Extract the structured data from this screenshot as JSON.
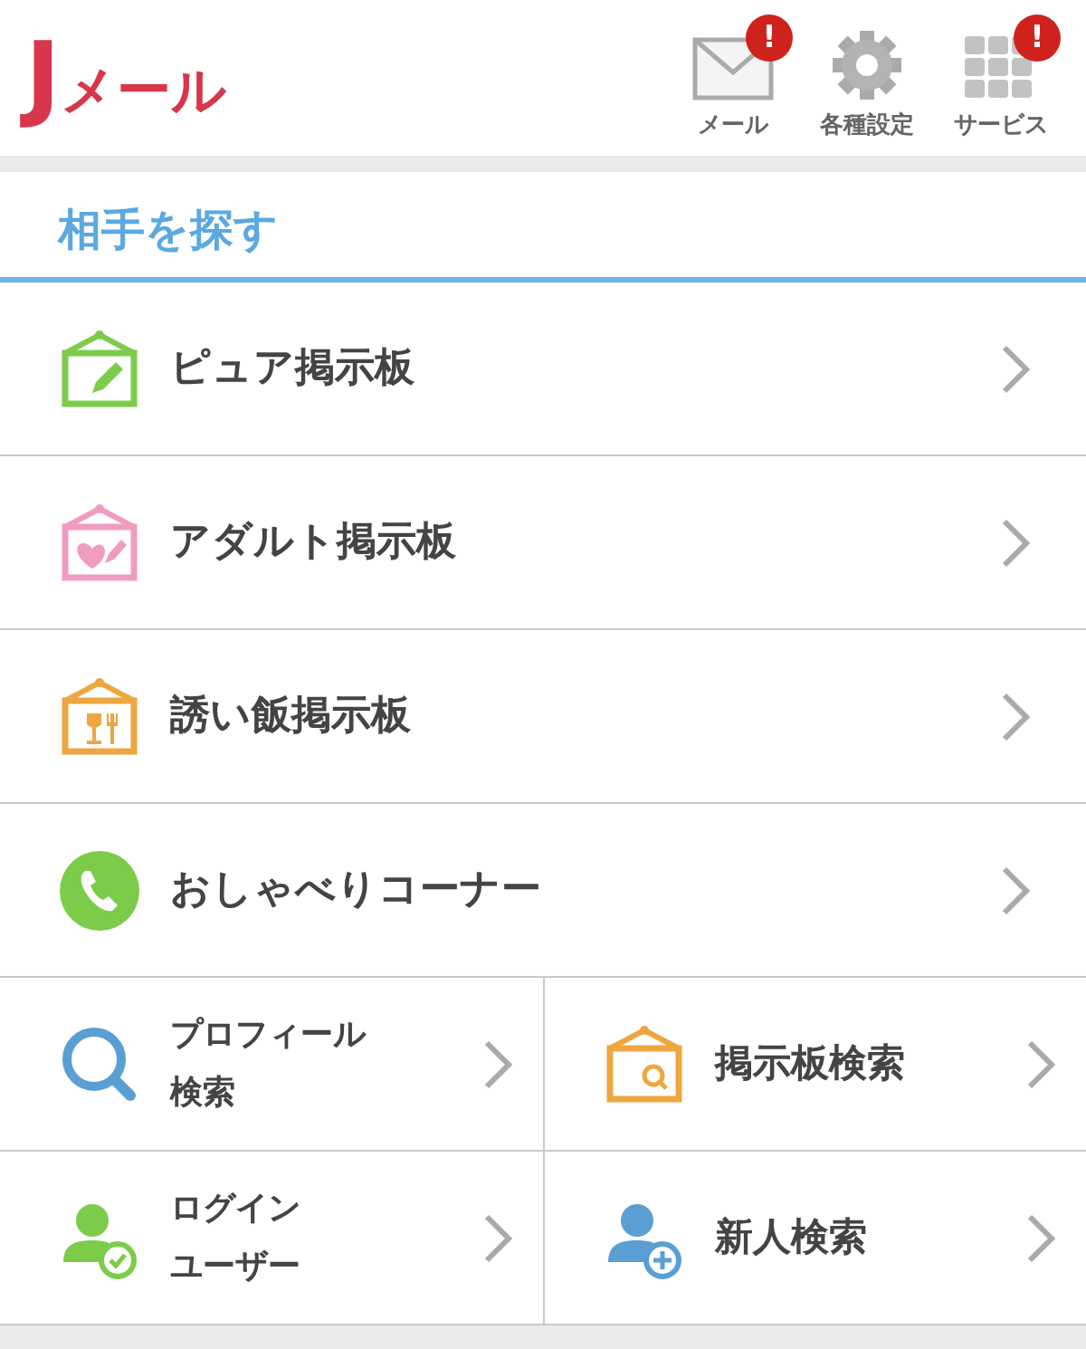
{
  "header": {
    "logo": {
      "initial": "J",
      "rest": "メール"
    },
    "actions": [
      {
        "kind": "mail",
        "label": "メール",
        "badge": "!"
      },
      {
        "kind": "gear",
        "label": "各種設定"
      },
      {
        "kind": "grid",
        "label": "サービス",
        "badge": "!"
      }
    ]
  },
  "section": {
    "title": "相手を探す"
  },
  "menu": [
    {
      "kind": "board-pencil",
      "label": "ピュア掲示板"
    },
    {
      "kind": "board-heart",
      "label": "アダルト掲示板"
    },
    {
      "kind": "board-food",
      "label": "誘い飯掲示板"
    },
    {
      "kind": "phone",
      "label": "おしゃべりコーナー"
    }
  ],
  "grid": [
    {
      "kind": "search",
      "lines": [
        "プロフィール",
        "検索"
      ]
    },
    {
      "kind": "board-search",
      "lines": [
        "掲示板検索"
      ]
    },
    {
      "kind": "user-check",
      "lines": [
        "ログイン",
        "ユーザー"
      ]
    },
    {
      "kind": "user-plus",
      "lines": [
        "新人検索"
      ]
    }
  ]
}
